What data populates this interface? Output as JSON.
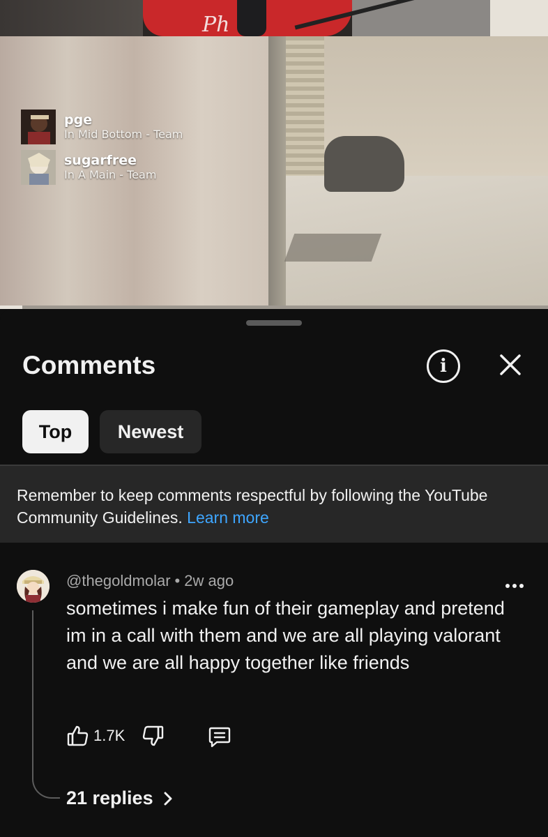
{
  "video": {
    "players": [
      {
        "name": "pge",
        "location": "In Mid Bottom - Team",
        "avatar_color": "#3b2c24"
      },
      {
        "name": "sugarfree",
        "location": "In A Main - Team",
        "avatar_color": "#c9c3b5"
      }
    ],
    "shirt_logo": "Ph"
  },
  "comments_panel": {
    "title": "Comments",
    "info_icon": "info-icon",
    "close_icon": "close-icon",
    "tabs": [
      {
        "label": "Top",
        "selected": true
      },
      {
        "label": "Newest",
        "selected": false
      }
    ],
    "guidelines": {
      "text": "Remember to keep comments respectful by following the YouTube Community Guidelines.",
      "link_label": "Learn more",
      "link_color": "#3ea6ff"
    },
    "comment": {
      "author": "@thegoldmolar",
      "separator": "•",
      "time": "2w ago",
      "text": "sometimes i make fun of their gameplay and pretend im in a call with them and we are all playing valorant and we are all happy together like friends",
      "likes": "1.7K",
      "replies_label": "21 replies"
    }
  },
  "colors": {
    "background": "#0f0f0f",
    "notice_bg": "#272727",
    "text": "#f1f1f1",
    "secondary_text": "#aaaaaa"
  }
}
